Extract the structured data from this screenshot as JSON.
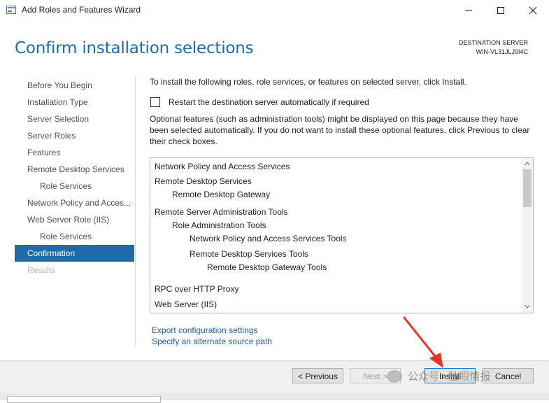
{
  "window": {
    "title": "Add Roles and Features Wizard",
    "icon": "server-manager-icon"
  },
  "header": {
    "page_title": "Confirm installation selections",
    "destination_label": "DESTINATION SERVER",
    "destination_server": "WIN-VL31JLJ9I4C"
  },
  "nav": {
    "items": [
      {
        "label": "Before You Begin",
        "state": "normal"
      },
      {
        "label": "Installation Type",
        "state": "normal"
      },
      {
        "label": "Server Selection",
        "state": "normal"
      },
      {
        "label": "Server Roles",
        "state": "normal"
      },
      {
        "label": "Features",
        "state": "normal"
      },
      {
        "label": "Remote Desktop Services",
        "state": "normal"
      },
      {
        "label": "Role Services",
        "state": "sub"
      },
      {
        "label": "Network Policy and Acces...",
        "state": "normal"
      },
      {
        "label": "Web Server Role (IIS)",
        "state": "normal"
      },
      {
        "label": "Role Services",
        "state": "sub"
      },
      {
        "label": "Confirmation",
        "state": "active"
      },
      {
        "label": "Results",
        "state": "disabled"
      }
    ]
  },
  "content": {
    "intro": "To install the following roles, role services, or features on selected server, click Install.",
    "restart_label": "Restart the destination server automatically if required",
    "restart_checked": false,
    "optional_note": "Optional features (such as administration tools) might be displayed on this page because they have been selected automatically. If you do not want to install these optional features, click Previous to clear their check boxes.",
    "selections": [
      {
        "text": "Network Policy and Access Services",
        "level": 0
      },
      {
        "text": "Remote Desktop Services",
        "level": 0
      },
      {
        "text": "Remote Desktop Gateway",
        "level": 1
      },
      {
        "text": "Remote Server Administration Tools",
        "level": 0
      },
      {
        "text": "Role Administration Tools",
        "level": 1
      },
      {
        "text": "Network Policy and Access Services Tools",
        "level": 2
      },
      {
        "text": "Remote Desktop Services Tools",
        "level": 2
      },
      {
        "text": "Remote Desktop Gateway Tools",
        "level": 3
      },
      {
        "text": "RPC over HTTP Proxy",
        "level": 0
      },
      {
        "text": "Web Server (IIS)",
        "level": 0
      }
    ],
    "export_link": "Export configuration settings",
    "source_link": "Specify an alternate source path"
  },
  "footer": {
    "previous": "< Previous",
    "next": "Next >",
    "install": "Install",
    "cancel": "Cancel"
  },
  "watermark": "公众号 · 独眼情报",
  "colors": {
    "accent": "#1f6ba5",
    "link": "#1a5d9a",
    "annotation_arrow": "#e8332a"
  }
}
